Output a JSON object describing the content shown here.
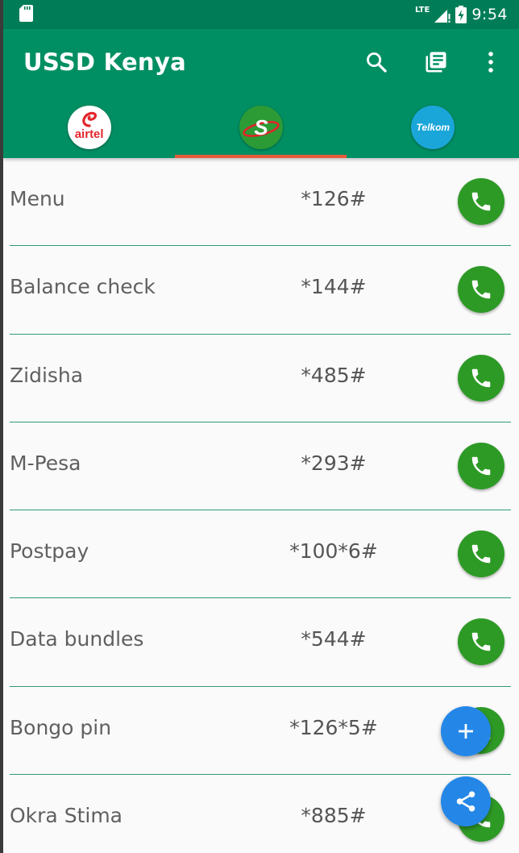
{
  "status_bar": {
    "network": "LTE",
    "time": "9:54",
    "icons": [
      "sd-card-icon",
      "signal-icon",
      "battery-charging-icon"
    ]
  },
  "app_bar": {
    "title": "USSD Kenya",
    "actions": [
      "search-icon",
      "news-icon",
      "more-vert-icon"
    ]
  },
  "tabs": [
    {
      "id": "airtel",
      "label": "airtel",
      "selected": false
    },
    {
      "id": "safaricom",
      "label": "S",
      "selected": true
    },
    {
      "id": "telkom",
      "label": "Telkom",
      "selected": false
    }
  ],
  "codes": [
    {
      "name": "Menu",
      "code": "*126#"
    },
    {
      "name": "Balance check",
      "code": "*144#"
    },
    {
      "name": "Zidisha",
      "code": "*485#"
    },
    {
      "name": "M-Pesa",
      "code": "*293#"
    },
    {
      "name": "Postpay",
      "code": "*100*6#"
    },
    {
      "name": "Data bundles",
      "code": "*544#"
    },
    {
      "name": "Bongo pin",
      "code": "*126*5#"
    },
    {
      "name": "Okra Stima",
      "code": "*885#"
    }
  ],
  "fabs": [
    "add-icon",
    "share-icon"
  ],
  "colors": {
    "app_bar": "#008f63",
    "status_bar": "#007d57",
    "tab_indicator": "#e8593a",
    "call_button": "#2e9a26",
    "fab": "#2487e7",
    "divider": "#2f9a74"
  }
}
